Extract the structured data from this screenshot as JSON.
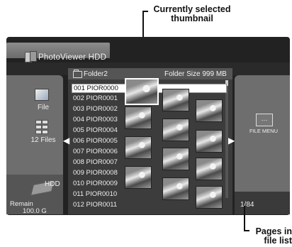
{
  "callouts": {
    "thumbnail": "Currently selected thumbnail",
    "pages": "Pages in file list"
  },
  "header": {
    "title": "PhotoViewer HDD",
    "folder_name": "Folder2",
    "folder_size": "Folder Size 999 MB"
  },
  "left_panel": {
    "file_label": "File",
    "files_count": "12 Files",
    "hdd_label": "HDD",
    "remain_label": "Remain",
    "remain_value": "100.0 G"
  },
  "right_panel": {
    "menu_label": "FILE MENU",
    "menu_icon_text": "···",
    "page_count": "1/84"
  },
  "files": [
    {
      "label": "001  PIOR0000"
    },
    {
      "label": "002  PIOR0001"
    },
    {
      "label": "003  PIOR0002"
    },
    {
      "label": "004  PIOR0003"
    },
    {
      "label": "005  PIOR0004"
    },
    {
      "label": "006  PIOR0005"
    },
    {
      "label": "007  PIOR0006"
    },
    {
      "label": "008  PIOR0007"
    },
    {
      "label": "009  PIOR0008"
    },
    {
      "label": "010  PIOR0009"
    },
    {
      "label": "011  PIOR0010"
    },
    {
      "label": "012  PIOR0011"
    }
  ],
  "selected_index": 0,
  "icons": {
    "app": "photoviewer-icon",
    "folder": "folder-icon",
    "file": "image-icon",
    "grid": "file-grid-icon",
    "hdd": "hdd-icon",
    "menu": "file-menu-icon",
    "left_arrow": "arrow-left-icon",
    "right_arrow": "arrow-right-icon"
  }
}
